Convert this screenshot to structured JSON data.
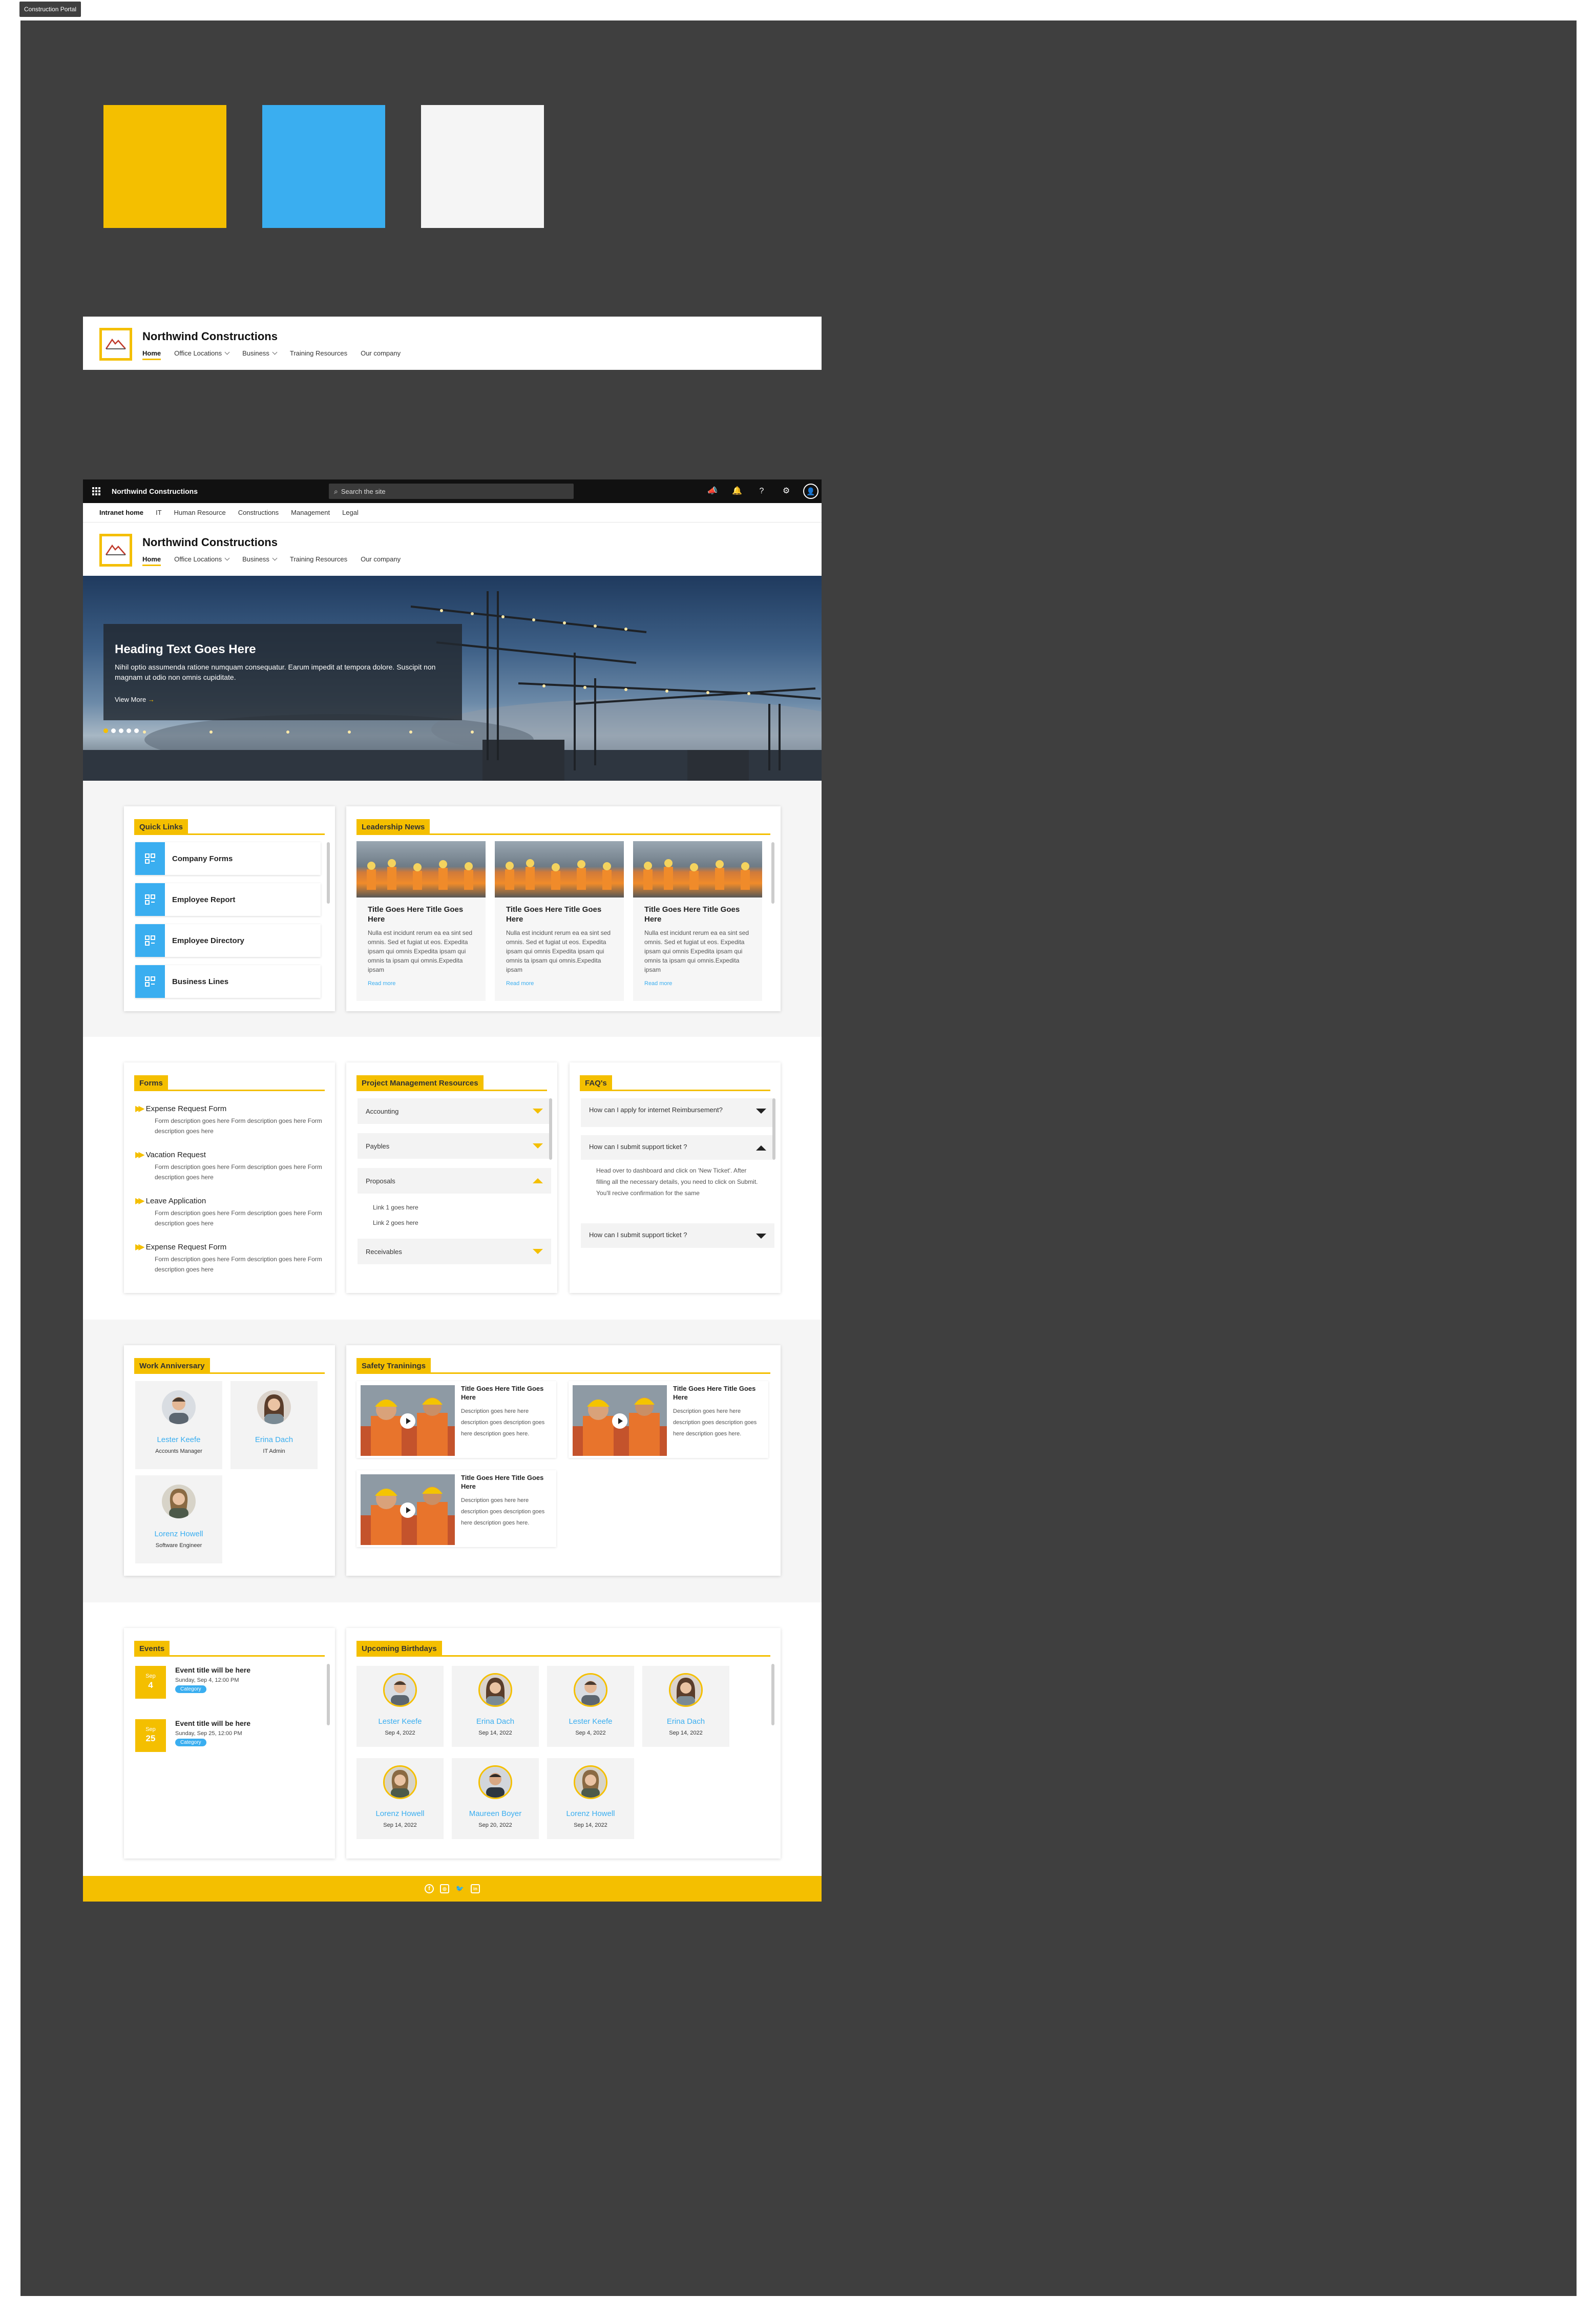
{
  "frame": {
    "label": "Construction Portal"
  },
  "colors": {
    "primary": "#f4bf00",
    "accent": "#3aaef0",
    "light": "#f5f5f5"
  },
  "site": {
    "title": "Northwind Constructions",
    "nav": [
      "Home",
      "Office Locations",
      "Business",
      "Training Resources",
      "Our company"
    ]
  },
  "suitebar": {
    "title": "Northwind Constructions",
    "search_placeholder": "Search the site",
    "icons": [
      "megaphone-icon",
      "bell-icon",
      "help-icon",
      "settings-icon",
      "user-avatar-icon"
    ]
  },
  "hubnav": [
    "Intranet home",
    "IT",
    "Human Resource",
    "Constructions",
    "Management",
    "Legal"
  ],
  "hero": {
    "heading": "Heading Text Goes Here",
    "text": "Nihil optio assumenda ratione numquam consequatur. Earum impedit at tempora dolore. Suscipit non magnam ut odio non omnis cupiditate.",
    "link": "View More"
  },
  "quick_links": {
    "title": "Quick Links",
    "items": [
      "Company Forms",
      "Employee Report",
      "Employee Directory",
      "Business Lines"
    ]
  },
  "leadership_news": {
    "title": "Leadership News",
    "items": [
      {
        "title": "Title Goes Here Title Goes Here",
        "desc": "Nulla est incidunt rerum ea ea sint sed omnis. Sed et fugiat ut eos. Expedita ipsam qui omnis Expedita ipsam qui omnis ta ipsam qui omnis.Expedita ipsam",
        "link": "Read more"
      },
      {
        "title": "Title Goes Here Title Goes Here",
        "desc": "Nulla est incidunt rerum ea ea sint sed omnis. Sed et fugiat ut eos. Expedita ipsam qui omnis Expedita ipsam qui omnis ta ipsam qui omnis.Expedita ipsam",
        "link": "Read more"
      },
      {
        "title": "Title Goes Here Title Goes Here",
        "desc": "Nulla est incidunt rerum ea ea sint sed omnis. Sed et fugiat ut eos. Expedita ipsam qui omnis Expedita ipsam qui omnis ta ipsam qui omnis.Expedita ipsam",
        "link": "Read more"
      }
    ]
  },
  "forms": {
    "title": "Forms",
    "items": [
      {
        "title": "Expense Request Form",
        "desc": "Form description goes here Form description goes here Form description goes here"
      },
      {
        "title": "Vacation Request",
        "desc": "Form description goes here Form description goes here Form description goes here"
      },
      {
        "title": "Leave Application",
        "desc": "Form description goes here Form description goes here Form description goes here"
      },
      {
        "title": "Expense Request Form",
        "desc": "Form description goes here Form description goes here Form description goes here"
      }
    ]
  },
  "pm_resources": {
    "title": "Project Management Resources",
    "sections": [
      "Accounting",
      "Paybles",
      "Proposals",
      "Receivables"
    ],
    "links": [
      "Link 1 goes here",
      "Link 2 goes here"
    ]
  },
  "faqs": {
    "title": "FAQ's",
    "q1": "How can I apply for internet Reimbursement?",
    "q2": "How can I submit support ticket ?",
    "a2": "Head over to dashboard and click on 'New Ticket'. After filling all the necessary details, you need to click on Submit. You'll recive confirmation for the same",
    "q3": "How can I submit support ticket ?"
  },
  "work_anniversary": {
    "title": "Work Anniversary",
    "people": [
      {
        "name": "Lester Keefe",
        "role": "Accounts Manager"
      },
      {
        "name": "Erina Dach",
        "role": "IT Admin"
      },
      {
        "name": "Lorenz Howell",
        "role": "Software Engineer"
      }
    ]
  },
  "safety_trainings": {
    "title": "Safety Traninings",
    "items": [
      {
        "title": "Title Goes Here Title Goes Here",
        "desc": "Description goes here here description goes description goes here description goes here."
      },
      {
        "title": "Title Goes Here Title Goes Here",
        "desc": "Description goes here here description goes description goes here description goes here."
      },
      {
        "title": "Title Goes Here Title Goes Here",
        "desc": "Description goes here here description goes description goes here description goes here."
      }
    ]
  },
  "events": {
    "title": "Events",
    "items": [
      {
        "month": "Sep",
        "day": "4",
        "title": "Event title will be here",
        "time": "Sunday, Sep 4, 12:00 PM",
        "category": "Category"
      },
      {
        "month": "Sep",
        "day": "25",
        "title": "Event title will be here",
        "time": "Sunday, Sep 25, 12:00 PM",
        "category": "Category"
      }
    ]
  },
  "birthdays": {
    "title": "Upcoming Birthdays",
    "people": [
      {
        "name": "Lester Keefe",
        "date": "Sep 4, 2022"
      },
      {
        "name": "Erina Dach",
        "date": "Sep 14, 2022"
      },
      {
        "name": "Lester Keefe",
        "date": "Sep 4, 2022"
      },
      {
        "name": "Erina Dach",
        "date": "Sep 14, 2022"
      },
      {
        "name": "Lorenz Howell",
        "date": "Sep 14, 2022"
      },
      {
        "name": "Maureen Boyer",
        "date": "Sep 20, 2022"
      },
      {
        "name": "Lorenz Howell",
        "date": "Sep 14, 2022"
      }
    ]
  },
  "footer": {
    "social": [
      "facebook-icon",
      "instagram-icon",
      "twitter-icon",
      "linkedin-icon"
    ]
  }
}
